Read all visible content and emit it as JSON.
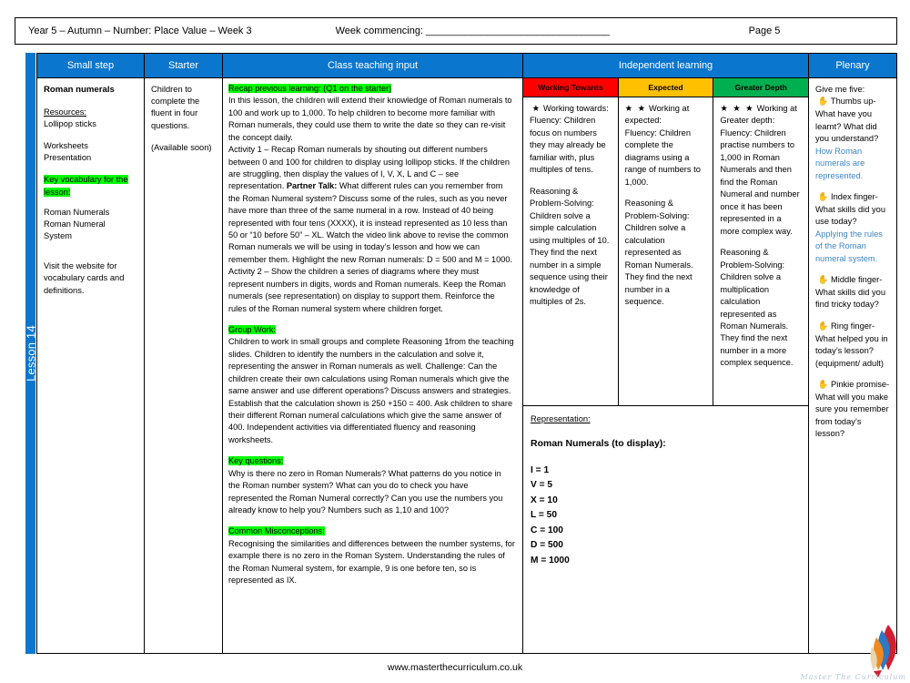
{
  "header": {
    "title": "Year 5 – Autumn – Number: Place Value – Week 3",
    "week_commencing": "Week commencing: _________________________________",
    "page": "Page 5"
  },
  "spine": {
    "lesson_label": "Lesson 14"
  },
  "columns": {
    "small_step": "Small step",
    "starter": "Starter",
    "class_teaching_input": "Class teaching input",
    "independent_learning": "Independent learning",
    "plenary": "Plenary"
  },
  "bands": [
    {
      "label": "Working Towards",
      "color": "#FF0000"
    },
    {
      "label": "Expected",
      "color": "#FFC000"
    },
    {
      "label": "Greater Depth",
      "color": "#00B050"
    }
  ],
  "small_step": {
    "title": "Roman numerals",
    "resources_label": "Resources:",
    "resources_1": "Lollipop sticks",
    "resources_2": "Worksheets",
    "resources_3": "Presentation",
    "key_vocab_heading": "Key vocabulary for the lesson:",
    "vocab_1": "Roman Numerals",
    "vocab_2": "Roman Numeral",
    "vocab_3": "System",
    "website_note": "Visit the website for vocabulary cards and definitions."
  },
  "starter": {
    "line_1": "Children to complete the fluent in four questions.",
    "line_2": "(Available soon)"
  },
  "teaching": {
    "recap_heading": "Recap previous learning: (Q1 on the starter)",
    "recap_body": "In this lesson, the children will extend their knowledge of Roman numerals to 100 and work up to 1,000. To help children to become more familiar with Roman numerals, they could use them to write the date so they can re-visit the concept daily.",
    "activity1_pre": "Activity 1 – Recap Roman numerals by shouting out different numbers between 0 and 100 for children to display using lollipop sticks. If the children are struggling, then display the values of I, V, X, L and C – see representation. ",
    "activity1_bold": "Partner Talk:",
    "activity1_post": " What different rules can you remember from the Roman Numeral system? Discuss some of the rules, such as you never have more than three of the same numeral in a row. Instead of 40 being represented with four tens (XXXX), it is instead represented as 10 less than 50 or “10 before 50” – XL. Watch the video link above to revise the common Roman numerals we will be using in today’s lesson and how we can remember them. Highlight the new Roman numerals: D = 500 and M = 1000.",
    "activity2": "Activity 2 – Show the children a series of diagrams where they must represent numbers in digits, words and Roman numerals. Keep the Roman numerals (see representation) on display to support them. Reinforce the rules of the Roman numeral system where children forget.",
    "group_work_heading": "Group Work:",
    "group_work_body": "Children to work in small groups and complete Reasoning 1from the teaching slides. Children to identify the numbers in the calculation and solve it, representing the answer in Roman numerals as well. Challenge: Can the children create their own calculations using Roman numerals which give the same answer and use different operations? Discuss answers and strategies. Establish that the calculation shown is 250 +150 = 400. Ask children to share their different Roman numeral calculations which give the same answer of 400. Independent activities via differentiated fluency and reasoning worksheets.",
    "key_questions_heading": "Key questions:",
    "key_questions_body": "Why is there no zero in Roman Numerals? What patterns do you notice in the Roman number system? What can you do to check you have represented the Roman Numeral correctly? Can you use the numbers you already know to help you? Numbers such as 1,10 and 100?",
    "misconceptions_heading": "Common Misconceptions:",
    "misconceptions_body": "Recognising the similarities and differences between the number systems, for example there is no zero in the Roman System. Understanding the rules of the Roman Numeral system, for example, 9 is one before ten, so is represented as IX."
  },
  "independent": {
    "working_towards": {
      "stars": "★",
      "heading": "Working towards:",
      "fluency": "Fluency: Children focus on numbers they may already be familiar with, plus multiples of tens.",
      "reasoning": "Reasoning & Problem-Solving: Children solve a simple calculation using multiples of 10. They find the next number in a simple sequence using their knowledge of multiples of 2s."
    },
    "expected": {
      "stars": "★ ★",
      "heading": "Working at expected:",
      "fluency": "Fluency: Children complete the diagrams using a range of numbers to 1,000.",
      "reasoning": "Reasoning & Problem-Solving: Children solve a calculation represented as Roman Numerals. They find the next number in a sequence."
    },
    "greater_depth": {
      "stars": "★ ★ ★",
      "heading": "Working at Greater depth:",
      "fluency": "Fluency: Children practise numbers to 1,000 in Roman Numerals and then find the Roman Numeral and number once it has been represented in a more complex way.",
      "reasoning": "Reasoning & Problem-Solving: Children solve a multiplication calculation represented as Roman Numerals. They find the next number in a more complex sequence."
    }
  },
  "representation": {
    "label": "Representation:",
    "subtitle": "Roman Numerals (to display):",
    "numerals": [
      "I = 1",
      "V = 5",
      "X = 10",
      "L = 50",
      "C = 100",
      "D = 500",
      "M = 1000"
    ]
  },
  "plenary": {
    "intro": "Give me five:",
    "items": [
      {
        "icon": "hand-icon",
        "text": " Thumbs up- What have you learnt? What did you understand?",
        "answer": "How Roman numerals are represented."
      },
      {
        "icon": "hand-icon",
        "text": " Index finger- What skills did you use today?",
        "answer": "Applying the rules of the Roman numeral system."
      },
      {
        "icon": "hand-icon",
        "text": " Middle finger- What skills did you find tricky today?",
        "answer": ""
      },
      {
        "icon": "hand-icon",
        "text": " Ring finger- What helped you in today’s lesson? (equipment/ adult)",
        "answer": ""
      },
      {
        "icon": "hand-icon",
        "text": " Pinkie promise- What will you make sure you remember from today’s lesson?",
        "answer": ""
      }
    ]
  },
  "footer": {
    "url": "www.masterthecurriculum.co.uk",
    "logo_text": "Master The Curriculum"
  }
}
